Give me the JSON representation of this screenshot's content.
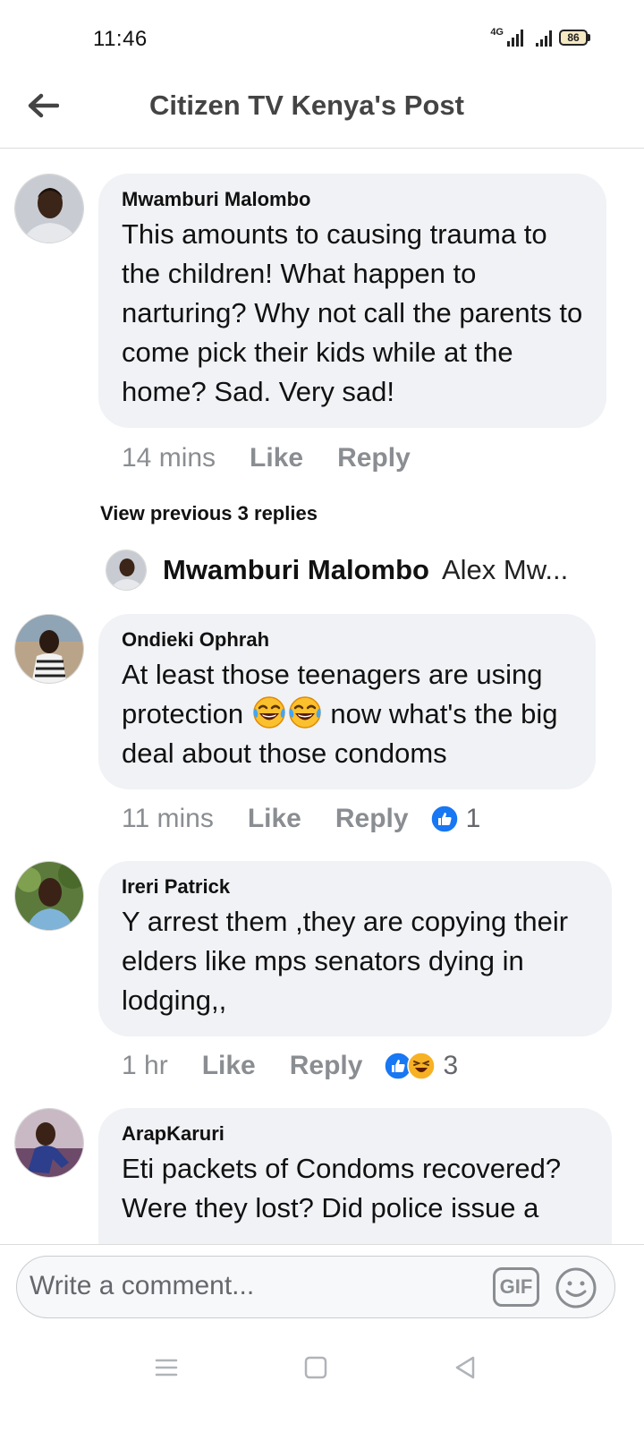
{
  "status_bar": {
    "time": "11:46",
    "network": "4G",
    "battery": "86",
    "icons": [
      "signal-icon",
      "signal-icon",
      "battery-icon"
    ]
  },
  "header": {
    "title": "Citizen TV Kenya's Post",
    "back_icon": "back-arrow-icon"
  },
  "comments": [
    {
      "author": "Mwamburi Malombo",
      "text": "This amounts to causing trauma to the children! What happen to narturing? Why not call the parents to come pick their kids while at the home? Sad. Very sad!",
      "time": "14 mins",
      "like": "Like",
      "reply": "Reply"
    },
    {
      "author": "Ondieki Ophrah",
      "text_before": "At least those teenagers are using protection",
      "emojis": [
        "laughing-tears-emoji",
        "laughing-tears-emoji"
      ],
      "text_after": "now what's the big deal about those condoms",
      "time": "11 mins",
      "like": "Like",
      "reply": "Reply",
      "reaction_count": "1",
      "reaction_icons": [
        "like-reaction-icon"
      ]
    },
    {
      "author": "Ireri Patrick",
      "text": "Y arrest them ,they are copying their elders like mps senators dying in lodging,,",
      "time": "1 hr",
      "like": "Like",
      "reply": "Reply",
      "reaction_count": "3",
      "reaction_icons": [
        "like-reaction-icon",
        "haha-reaction-icon"
      ]
    },
    {
      "author": "ArapKaruri",
      "text": "Eti packets of Condoms recovered? Were they lost? Did police issue a"
    }
  ],
  "replies": {
    "view_previous": "View previous 3 replies",
    "preview_author": "Mwamburi Malombo",
    "preview_snippet": "Alex Mw..."
  },
  "composer": {
    "placeholder": "Write a comment...",
    "gif_label": "GIF",
    "emoji_icon": "smiley-icon"
  },
  "nav": {
    "icons": [
      "menu-icon",
      "home-square-icon",
      "back-triangle-icon"
    ]
  },
  "colors": {
    "bubble": "#f0f2f5",
    "meta_text": "#8a8d91",
    "like_blue": "#1877f2",
    "haha_yellow": "#f7b125"
  }
}
